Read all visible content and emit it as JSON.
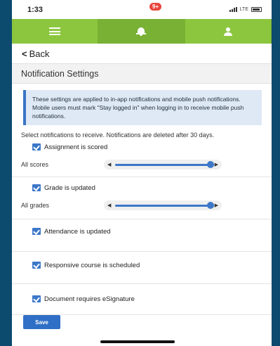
{
  "status_bar": {
    "time": "1:33",
    "network": "LTE"
  },
  "nav": {
    "menu_icon": "hamburger-menu-icon",
    "bell_icon": "bell-icon",
    "badge": "9+",
    "user_icon": "user-icon"
  },
  "back": {
    "label": "Back"
  },
  "section": {
    "title": "Notification Settings"
  },
  "info": {
    "text": "These settings are applied to in-app notifications and mobile push notifications. Mobile users must mark \"Stay logged in\" when logging in to receive mobile push notifications."
  },
  "intro": "Select notifications to receive. Notifications are deleted after 30 days.",
  "notifications": [
    {
      "label": "Assignment is scored",
      "checked": true,
      "slider_label": "All scores",
      "slider_level": 1.0
    },
    {
      "label": "Grade is updated",
      "checked": true,
      "slider_label": "All grades",
      "slider_level": 1.0
    },
    {
      "label": "Attendance is updated",
      "checked": true
    },
    {
      "label": "Responsive course is scheduled",
      "checked": true
    },
    {
      "label": "Document requires eSignature",
      "checked": true
    }
  ],
  "save_label": "Save",
  "colors": {
    "nav_green": "#8cc63f",
    "accent_blue": "#3c77c8",
    "badge_red": "#e8453c"
  }
}
